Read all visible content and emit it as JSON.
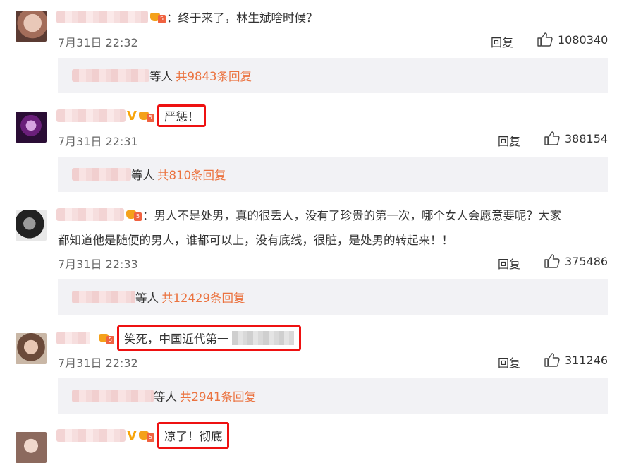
{
  "comments": [
    {
      "text": "：终于来了，林生斌啥时候？",
      "time": "7月31日 22:32",
      "reply_label": "回复",
      "likes": "1080340",
      "replies": {
        "suffix": "等人",
        "count_text": "共9843条回复"
      }
    },
    {
      "text": "严惩！",
      "time": "7月31日 22:31",
      "reply_label": "回复",
      "likes": "388154",
      "replies": {
        "suffix": "等人",
        "count_text": "共810条回复"
      }
    },
    {
      "text": "：男人不是处男，真的很丢人，没有了珍贵的第一次，哪个女人会愿意要呢？大家",
      "text2": "都知道他是随便的男人，谁都可以上，没有底线，很脏，是处男的转起来！！",
      "time": "7月31日 22:33",
      "reply_label": "回复",
      "likes": "375486",
      "replies": {
        "suffix": "等人",
        "count_text": "共12429条回复"
      }
    },
    {
      "text": "笑死，中国近代第一",
      "time": "7月31日 22:32",
      "reply_label": "回复",
      "likes": "311246",
      "replies": {
        "suffix": "等人",
        "count_text": "共2941条回复"
      }
    },
    {
      "text": "凉了！彻底"
    }
  ],
  "icons": {
    "vip": "V",
    "level": "5",
    "like": "thumbs-up-icon"
  },
  "colors": {
    "count": "#eb7340",
    "highlight": "#ee1111",
    "vip": "#f7a40a",
    "reply_bg": "#f2f2f5"
  }
}
